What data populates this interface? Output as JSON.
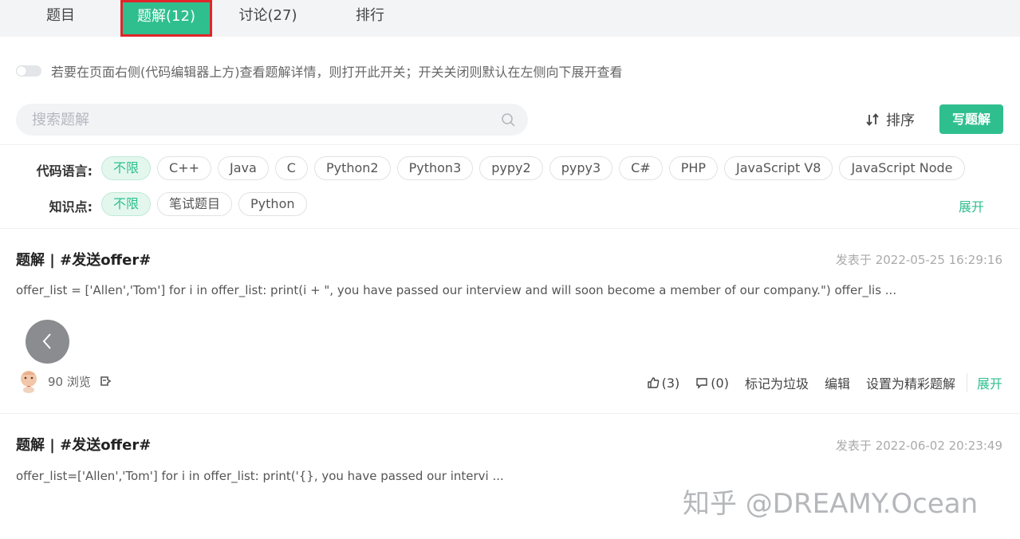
{
  "tabs": [
    {
      "label": "题目"
    },
    {
      "label": "题解(12)"
    },
    {
      "label": "讨论(27)"
    },
    {
      "label": "排行"
    }
  ],
  "toggle": {
    "label": "若要在页面右侧(代码编辑器上方)查看题解详情，则打开此开关；开关关闭则默认在左侧向下展开查看",
    "on": false
  },
  "search": {
    "placeholder": "搜索题解",
    "value": ""
  },
  "sort": {
    "label": "排序"
  },
  "write_button": {
    "label": "写题解"
  },
  "filters": {
    "language": {
      "label": "代码语言:",
      "options": [
        "不限",
        "C++",
        "Java",
        "C",
        "Python2",
        "Python3",
        "pypy2",
        "pypy3",
        "C#",
        "PHP",
        "JavaScript V8",
        "JavaScript Node"
      ],
      "selected": "不限"
    },
    "knowledge": {
      "label": "知识点:",
      "options": [
        "不限",
        "笔试题目",
        "Python"
      ],
      "selected": "不限",
      "expand_label": "展开"
    }
  },
  "posts": [
    {
      "title": "题解 | #发送offer#",
      "date": "发表于 2022-05-25 16:29:16",
      "excerpt": "offer_list = ['Allen','Tom'] for i in offer_list: print(i + \", you have passed our interview and will soon become a member of our company.\") offer_lis ...",
      "views": "90 浏览",
      "actions": {
        "like": "(3)",
        "comment": "(0)",
        "mark_spam": "标记为垃圾",
        "edit": "编辑",
        "set_featured": "设置为精彩题解",
        "expand": "展开"
      }
    },
    {
      "title": "题解 | #发送offer#",
      "date": "发表于 2022-06-02 20:23:49",
      "excerpt": "offer_list=['Allen','Tom'] for i in offer_list:     print('{}, you have passed our intervi ..."
    }
  ],
  "watermark": "知乎 @DREAMY.Ocean",
  "colors": {
    "accent": "#2fbf8f",
    "highlight_border": "#e0262a"
  }
}
